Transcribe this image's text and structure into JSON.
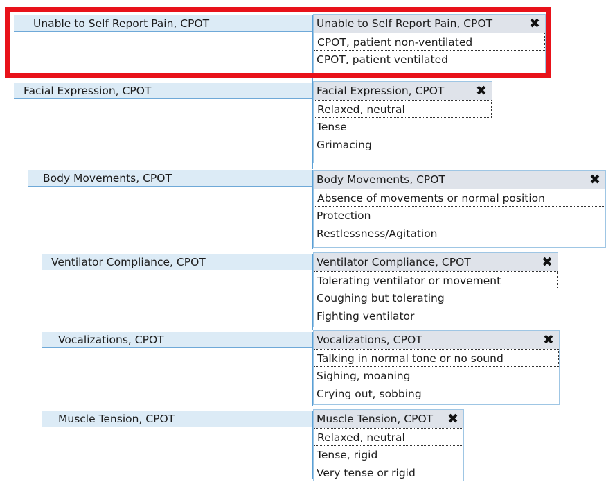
{
  "colors": {
    "highlight": "#e8121a",
    "label_bg": "#dcebf6",
    "header_bg": "#dfe3ea",
    "line": "#5aa0d6"
  },
  "groups": [
    {
      "label": "Unable to Self Report Pain, CPOT",
      "dropdown_title": "Unable to Self Report Pain, CPOT",
      "options": [
        "CPOT, patient non-ventilated",
        "CPOT, patient ventilated"
      ]
    },
    {
      "label": "Facial Expression, CPOT",
      "dropdown_title": "Facial Expression, CPOT",
      "options": [
        "Relaxed, neutral",
        "Tense",
        "Grimacing"
      ]
    },
    {
      "label": "Body Movements, CPOT",
      "dropdown_title": "Body Movements, CPOT",
      "options": [
        "Absence of movements or normal position",
        "Protection",
        "Restlessness/Agitation"
      ]
    },
    {
      "label": "Ventilator Compliance, CPOT",
      "dropdown_title": "Ventilator Compliance, CPOT",
      "options": [
        "Tolerating ventilator or movement",
        "Coughing but tolerating",
        "Fighting ventilator"
      ]
    },
    {
      "label": "Vocalizations, CPOT",
      "dropdown_title": "Vocalizations, CPOT",
      "options": [
        "Talking in normal tone or no sound",
        "Sighing, moaning",
        "Crying out, sobbing"
      ]
    },
    {
      "label": "Muscle Tension, CPOT",
      "dropdown_title": "Muscle Tension, CPOT",
      "options": [
        "Relaxed, neutral",
        "Tense, rigid",
        "Very tense or rigid"
      ]
    }
  ],
  "close_glyph": "✖"
}
